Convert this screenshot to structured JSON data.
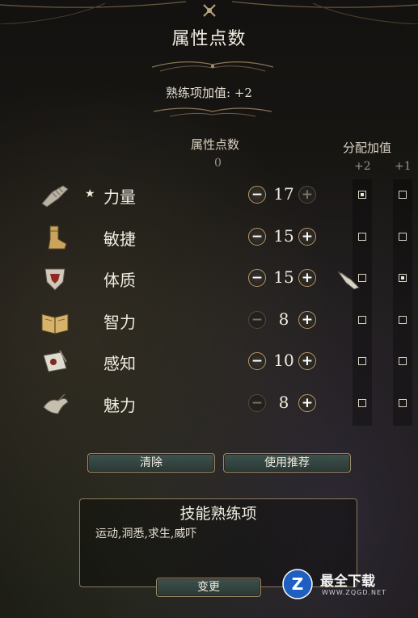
{
  "header": {
    "title": "属性点数"
  },
  "proficiency_bonus": "熟练项加值: +2",
  "columns": {
    "points_header": "属性点数",
    "points_remaining": "0",
    "bonus_header": "分配加值",
    "bonus_plus2": "+2",
    "bonus_plus1": "+1"
  },
  "attributes": [
    {
      "name": "力量",
      "value": "17",
      "primary": true,
      "icon": "gauntlet-icon",
      "plus2": true,
      "plus1": false
    },
    {
      "name": "敏捷",
      "value": "15",
      "primary": false,
      "icon": "boot-icon",
      "plus2": false,
      "plus1": false
    },
    {
      "name": "体质",
      "value": "15",
      "primary": false,
      "icon": "shield-icon",
      "plus2": false,
      "plus1": true
    },
    {
      "name": "智力",
      "value": "8",
      "primary": false,
      "icon": "book-icon",
      "plus2": false,
      "plus1": false
    },
    {
      "name": "感知",
      "value": "10",
      "primary": false,
      "icon": "scroll-icon",
      "plus2": false,
      "plus1": false
    },
    {
      "name": "魅力",
      "value": "8",
      "primary": false,
      "icon": "bird-icon",
      "plus2": false,
      "plus1": false
    }
  ],
  "star_glyph": "★",
  "buttons": {
    "clear": "清除",
    "recommend": "使用推荐",
    "change": "变更"
  },
  "skills": {
    "title": "技能熟练项",
    "list": "运动,洞悉,求生,威吓"
  },
  "watermark": {
    "name": "最全下载",
    "url": "WWW.ZQGD.NET",
    "logo_letter": "Z"
  }
}
